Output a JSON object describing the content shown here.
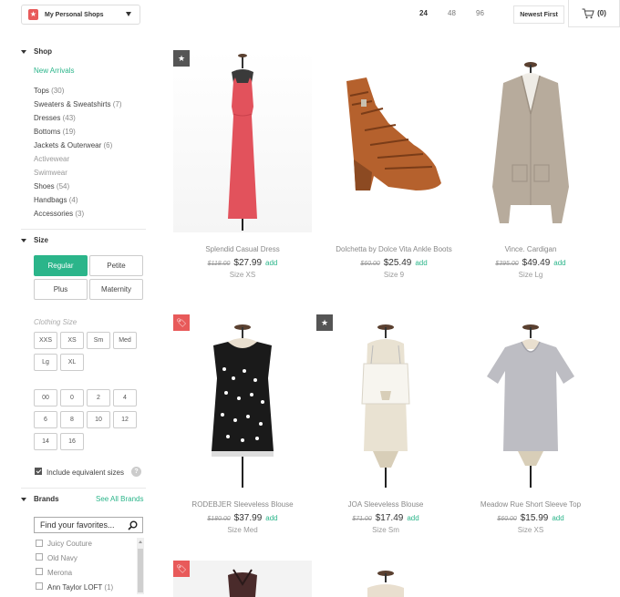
{
  "header": {
    "shop_badge": "★",
    "shop_select": "My Personal Shops",
    "per_page": [
      "24",
      "48",
      "96"
    ],
    "sort": "Newest First",
    "cart": "(0)"
  },
  "sidebar": {
    "shop_heading": "Shop",
    "categories": [
      {
        "label": "New Arrivals",
        "count": ""
      },
      {
        "label": "Tops",
        "count": "(30)"
      },
      {
        "label": "Sweaters & Sweatshirts",
        "count": "(7)"
      },
      {
        "label": "Dresses",
        "count": "(43)"
      },
      {
        "label": "Bottoms",
        "count": "(19)"
      },
      {
        "label": "Jackets & Outerwear",
        "count": "(6)"
      },
      {
        "label": "Activewear",
        "count": ""
      },
      {
        "label": "Swimwear",
        "count": ""
      },
      {
        "label": "Shoes",
        "count": "(54)"
      },
      {
        "label": "Handbags",
        "count": "(4)"
      },
      {
        "label": "Accessories",
        "count": "(3)"
      }
    ],
    "size_heading": "Size",
    "size_types": [
      "Regular",
      "Petite",
      "Plus",
      "Maternity"
    ],
    "clothing_size_label": "Clothing Size",
    "letter_sizes": [
      "XXS",
      "XS",
      "Sm",
      "Med",
      "Lg",
      "XL"
    ],
    "number_sizes": [
      "00",
      "0",
      "2",
      "4",
      "6",
      "8",
      "10",
      "12",
      "14",
      "16"
    ],
    "equivalent_label": "Include equivalent sizes",
    "help_glyph": "?",
    "brands_heading": "Brands",
    "see_all": "See All Brands",
    "favorites_placeholder": "Find your favorites...",
    "brands": [
      {
        "label": "Juicy Couture",
        "count": ""
      },
      {
        "label": "Old Navy",
        "count": ""
      },
      {
        "label": "Merona",
        "count": ""
      },
      {
        "label": "Ann Taylor LOFT",
        "count": "(1)"
      }
    ]
  },
  "products": [
    {
      "title": "Splendid Casual Dress",
      "old_price": "$118.00",
      "price": "$27.99",
      "add": "add",
      "size": "Size XS",
      "tag": "★",
      "icon": "star-icon"
    },
    {
      "title": "Dolchetta by Dolce Vita Ankle Boots",
      "old_price": "$60.00",
      "price": "$25.49",
      "add": "add",
      "size": "Size 9",
      "tag": "",
      "icon": ""
    },
    {
      "title": "Vince. Cardigan",
      "old_price": "$395.00",
      "price": "$49.49",
      "add": "add",
      "size": "Size Lg",
      "tag": "",
      "icon": ""
    },
    {
      "title": "RODEBJER Sleeveless Blouse",
      "old_price": "$180.00",
      "price": "$37.99",
      "add": "add",
      "size": "Size Med",
      "tag": "🏷",
      "icon": "price-tag-icon"
    },
    {
      "title": "JOA Sleeveless Blouse",
      "old_price": "$71.00",
      "price": "$17.49",
      "add": "add",
      "size": "Size Sm",
      "tag": "★",
      "icon": "star-icon"
    },
    {
      "title": "Meadow Rue Short Sleeve Top",
      "old_price": "$60.00",
      "price": "$15.99",
      "add": "add",
      "size": "Size XS",
      "tag": "",
      "icon": ""
    }
  ],
  "colors": {
    "accent": "#2bb58a",
    "sale_tag": "#e85a5a",
    "star_tag": "#555555",
    "dress": "#e2525c",
    "boots": "#b5612d",
    "cardigan": "#b7ab9c",
    "blouse_black": "#1a1a1a",
    "blouse_white": "#f4f1ea",
    "tee_gray": "#bdbdc3"
  }
}
